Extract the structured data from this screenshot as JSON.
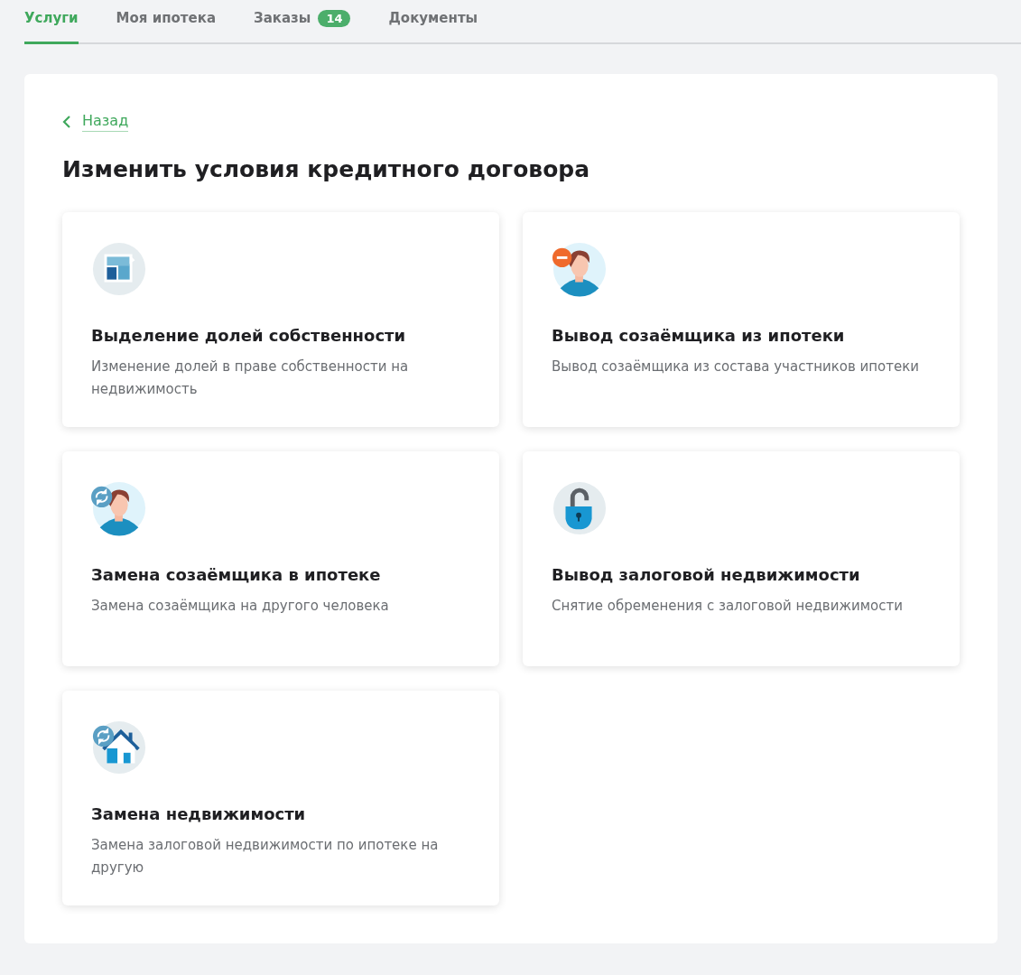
{
  "tabs": [
    {
      "label": "Услуги",
      "selected": true
    },
    {
      "label": "Моя ипотека",
      "selected": false
    },
    {
      "label": "Заказы",
      "selected": false,
      "badge": "14"
    },
    {
      "label": "Документы",
      "selected": false
    }
  ],
  "back_link": "Назад",
  "title": "Изменить условия кредитного договора",
  "cards": [
    {
      "kind": "shares",
      "title": "Выделение долей собственности",
      "description": "Изменение долей в праве собственности на недвижимость"
    },
    {
      "kind": "remove-person",
      "title": "Вывод созаёмщика из ипотеки",
      "description": "Вывод созаёмщика из состава участников ипотеки"
    },
    {
      "kind": "replace-person",
      "title": "Замена созаёмщика в ипотеке",
      "description": "Замена созаёмщика на другого человека"
    },
    {
      "kind": "unlock",
      "title": "Вывод залоговой недвижимости",
      "description": "Снятие обременения с залоговой недвижимости"
    },
    {
      "kind": "replace-property",
      "title": "Замена недвижимости",
      "description": "Замена залоговой недвижимости по ипотеке на другую"
    }
  ]
}
